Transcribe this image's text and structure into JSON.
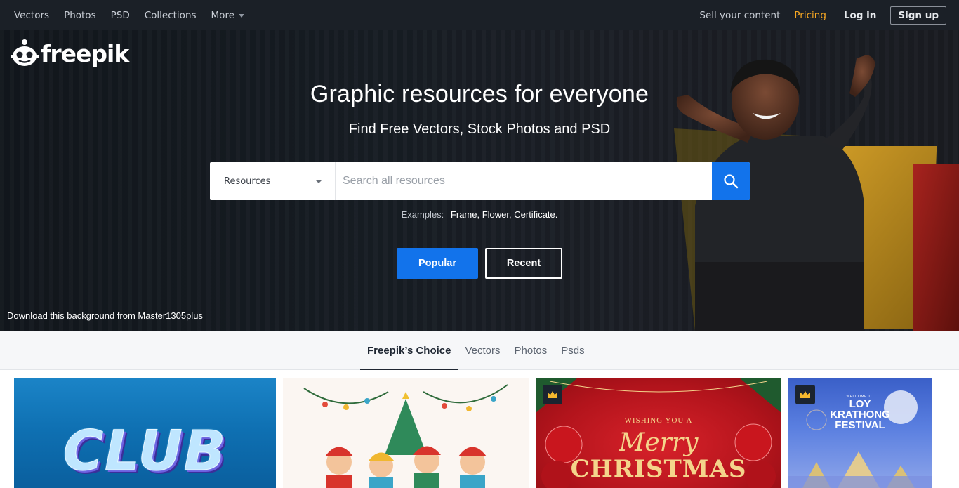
{
  "nav": {
    "left": [
      "Vectors",
      "Photos",
      "PSD",
      "Collections"
    ],
    "more": "More",
    "sell": "Sell your content",
    "pricing": "Pricing",
    "login": "Log in",
    "signup": "Sign up"
  },
  "brand": {
    "logo_text": "freepik",
    "accent": "#1273eb",
    "pricing_color": "#f5a623"
  },
  "hero": {
    "title": "Graphic resources for everyone",
    "subtitle": "Find Free Vectors, Stock Photos and PSD",
    "search": {
      "select_value": "Resources",
      "placeholder": "Search all resources"
    },
    "examples_label": "Examples:",
    "examples": [
      "Frame,",
      "Flower,",
      "Certificate."
    ],
    "popular_label": "Popular",
    "recent_label": "Recent",
    "credit": "Download this background from Master1305plus"
  },
  "tabs": [
    "Freepik’s Choice",
    "Vectors",
    "Photos",
    "Psds"
  ],
  "active_tab": 0,
  "gallery": {
    "club": "CLUB",
    "xmas_small": "WISHING YOU A",
    "xmas_merry": "Merry",
    "xmas_christmas": "CHRISTMAS",
    "loy_small": "WELCOME TO",
    "loy_lines": [
      "LOY",
      "KRATHONG",
      "FESTIVAL"
    ]
  },
  "icons": {
    "search": "search-icon",
    "crown": "crown-icon",
    "caret": "chevron-down-icon"
  }
}
